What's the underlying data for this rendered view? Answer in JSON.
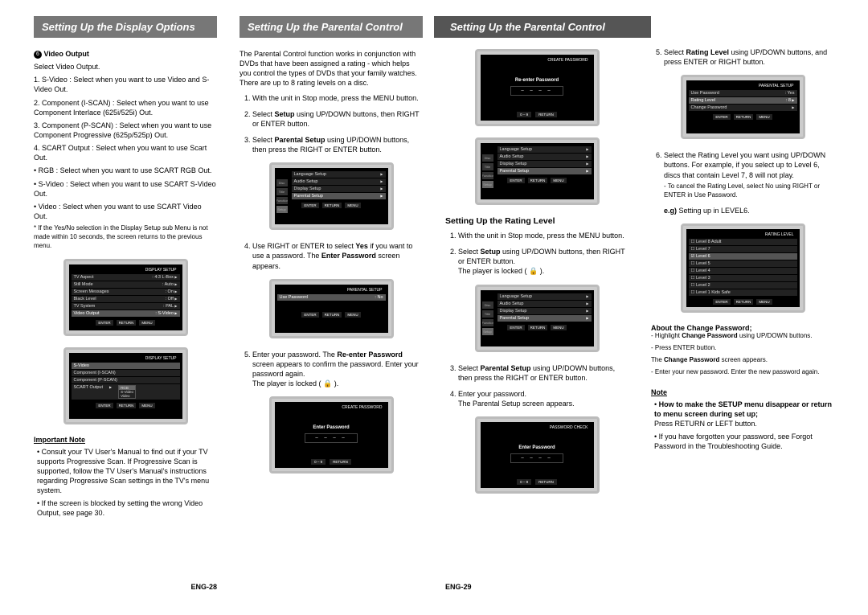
{
  "headers": {
    "col1": "Setting Up the Display Options",
    "col2": "Setting Up the Parental Control",
    "col3_4": "Setting Up the Parental Control"
  },
  "col1": {
    "video_output_label": "Video Output",
    "video_output_num": "6",
    "select_line": "Select Video Output.",
    "items": {
      "sv": "S-Video : Select when you want to use Video and S-Video Out.",
      "ci": "Component (I-SCAN) : Select when you want to use Component Interlace (625i/525i) Out.",
      "cp": "Component (P-SCAN) : Select when you want to use Component Progressive (625p/525p) Out.",
      "scart": "SCART Output : Select when you want to use Scart Out.",
      "rgb": "RGB : Select when you want to use SCART RGB Out.",
      "sv2": "S-Video : Select when you want to use SCART S-Video Out.",
      "vid": "Video : Select when you want to use SCART Video Out.",
      "note": "* If the Yes/No selection in the Display Setup sub Menu is not made within 10 seconds, the screen returns to the previous menu."
    },
    "important_head": "Important Note",
    "important1": "Consult your TV User's Manual to find out if your TV supports Progressive Scan. If Progressive Scan is supported, follow the TV User's Manual's instructions regarding Progressive Scan settings in the TV's menu system.",
    "important2": "If the screen is blocked by setting the wrong Video Output, see page 30.",
    "tv1": {
      "title": "DISPLAY SETUP",
      "r1a": "TV Aspect",
      "r1b": "4:3 L-Box",
      "r2a": "Still Mode",
      "r2b": "Auto",
      "r3a": "Screen Messages",
      "r3b": "On",
      "r4a": "Black Level",
      "r4b": "Off",
      "r5a": "TV System",
      "r5b": "PAL",
      "r6a": "Video Output",
      "r6b": "S-Video"
    },
    "tv2": {
      "title": "DISPLAY SETUP",
      "r1": "S-Video",
      "r2": "Component (I-SCAN)",
      "r3": "Component (P-SCAN)",
      "r4": "SCART Output",
      "o1": "RGB",
      "o2": "S-Video",
      "o3": "Video"
    },
    "btns": {
      "enter": "ENTER",
      "return": "RETURN",
      "menu": "MENU"
    }
  },
  "col2": {
    "intro": "The Parental Control function works in conjunction with DVDs that have been assigned a rating - which helps you control the types of DVDs that your family watches. There are up to 8 rating levels on a disc.",
    "s1": "With the unit in Stop mode, press the MENU button.",
    "s2a": "Select ",
    "s2b": "Setup",
    "s2c": " using UP/DOWN buttons, then RIGHT or ENTER button.",
    "s3a": "Select ",
    "s3b": "Parental Setup",
    "s3c": " using UP/DOWN buttons, then press the RIGHT or ENTER button.",
    "s4a": "Use RIGHT or ENTER to select ",
    "s4b": "Yes",
    "s4c": " if you want to use a password. The ",
    "s4d": "Enter Password",
    "s4e": " screen appears.",
    "s5a": "Enter your password. The ",
    "s5b": "Re-enter Password",
    "s5c": " screen appears to confirm the password. Enter your password again.",
    "s5d": "The player is locked ( 🔒 ).",
    "tv_menu": {
      "r1": "Language Setup",
      "r2": "Audio Setup",
      "r3": "Display Setup",
      "r4": "Parental Setup",
      "side1": "Disc Menu",
      "side2": "Title Menu",
      "side3": "Function",
      "side4": "Setup"
    },
    "tv_ps": {
      "title": "PARENTAL SETUP",
      "r1a": "Use Password",
      "r1b": "No"
    },
    "tv_cp": {
      "title": "CREATE PASSWORD",
      "label": "Enter Password"
    }
  },
  "col3": {
    "tv_re": {
      "title": "CREATE PASSWORD",
      "label": "Re-enter Password"
    },
    "tv_menu2": {
      "r1": "Language Setup",
      "r2": "Audio Setup",
      "r3": "Display Setup",
      "r4": "Parental Setup"
    },
    "subhead": "Setting Up the Rating Level",
    "s1": "With the unit in Stop mode, press the MENU button.",
    "s2a": "Select ",
    "s2b": "Setup",
    "s2c": " using UP/DOWN buttons, then RIGHT or ENTER button.",
    "s2d": "The player is locked ( 🔒 ).",
    "s3a": "Select ",
    "s3b": "Parental Setup",
    "s3c": " using UP/DOWN buttons, then press the RIGHT or ENTER button.",
    "s4": "Enter your password.",
    "s4b": "The Parental Setup screen appears.",
    "tv_pc": {
      "title": "PASSWORD CHECK",
      "label": "Enter Password"
    },
    "numpad": "0 – 9"
  },
  "col4": {
    "s5a": "Select ",
    "s5b": "Rating Level",
    "s5c": " using UP/DOWN buttons, and press ENTER or RIGHT button.",
    "tv_ps2": {
      "title": "PARENTAL SETUP",
      "r1a": "Use Password",
      "r1b": "Yes",
      "r2a": "Rating Level",
      "r2b": "8",
      "r3a": "Change Password"
    },
    "s6": "Select the Rating Level you want using UP/DOWN buttons. For example, if you select up to Level 6, discs that contain Level 7, 8 will not play.",
    "s6b": "- To cancel the Rating Level, select No using RIGHT or ENTER in Use Password.",
    "eg": "e.g)",
    "eg2": " Setting up in LEVEL6.",
    "tv_rl": {
      "title": "RATING LEVEL",
      "l8": "Level 8 Adult",
      "l7": "Level 7",
      "l6": "Level 6",
      "l5": "Level 5",
      "l4": "Level 4",
      "l3": "Level 3",
      "l2": "Level 2",
      "l1": "Level 1 Kids Safe"
    },
    "about_head": "About the Change Password;",
    "about1a": "- Highlight ",
    "about1b": "Change Password",
    "about1c": " using UP/DOWN buttons.",
    "about2": "- Press ENTER button.",
    "about3a": "  The ",
    "about3b": "Change Password",
    "about3c": " screen appears.",
    "about4": "- Enter your new password. Enter the new password again.",
    "note_head": "Note",
    "note1": "How to make the SETUP menu disappear or return to menu screen during set up;",
    "note1b": "Press RETURN or LEFT button.",
    "note2": "If you have forgotten your password, see Forgot Password in the Troubleshooting Guide."
  },
  "pagenums": {
    "left": "ENG-28",
    "right": "ENG-29"
  }
}
